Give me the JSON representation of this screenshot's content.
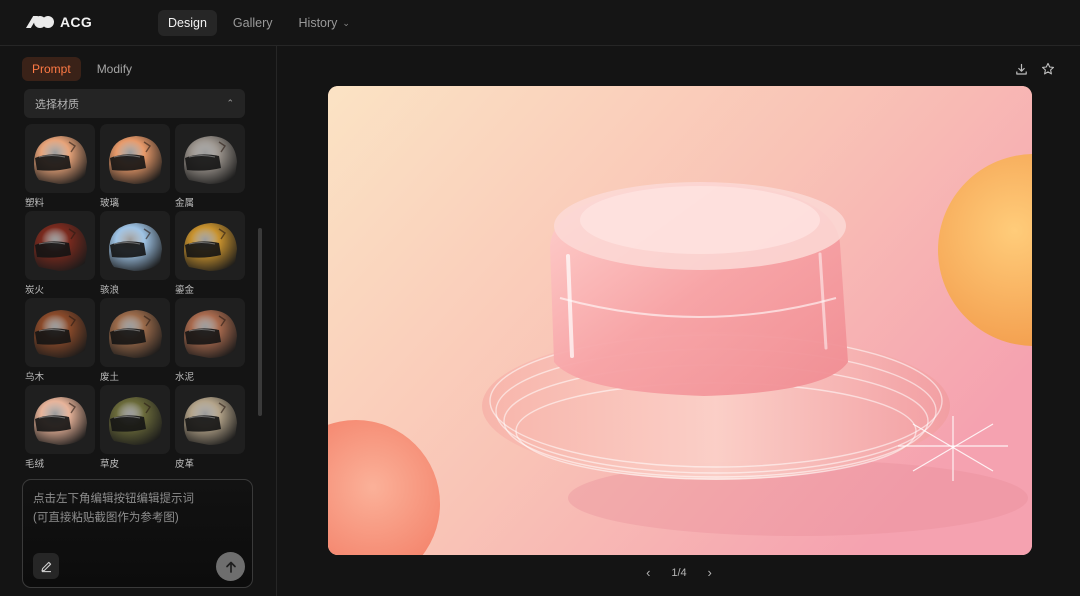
{
  "app": {
    "name": "ACG"
  },
  "nav": [
    {
      "label": "Design",
      "active": true
    },
    {
      "label": "Gallery",
      "active": false
    },
    {
      "label": "History",
      "active": false
    }
  ],
  "left": {
    "tabs": [
      {
        "label": "Prompt",
        "active": true
      },
      {
        "label": "Modify",
        "active": false
      }
    ],
    "material_select": {
      "label": "选择材质"
    },
    "materials": [
      {
        "label": "塑料",
        "color": "#e8a47a"
      },
      {
        "label": "玻璃",
        "color": "#e89a6a"
      },
      {
        "label": "金属",
        "color": "#9a938c"
      },
      {
        "label": "炭火",
        "color": "#7a2a1e"
      },
      {
        "label": "骇浪",
        "color": "#9fc4e6"
      },
      {
        "label": "鎏金",
        "color": "#c8922e"
      },
      {
        "label": "乌木",
        "color": "#8a4a2a"
      },
      {
        "label": "废土",
        "color": "#9a6a4a"
      },
      {
        "label": "水泥",
        "color": "#a86a4e"
      },
      {
        "label": "毛绒",
        "color": "#e8b49a"
      },
      {
        "label": "草皮",
        "color": "#6a6a3a"
      },
      {
        "label": "皮革",
        "color": "#b4a48a"
      }
    ],
    "prompt": {
      "placeholder": "点击左下角编辑按钮编辑提示词\n(可直接粘贴截图作为参考图)"
    }
  },
  "main": {
    "pager": {
      "text": "1/4"
    }
  },
  "colors": {
    "accent": "#ff7a45",
    "accent_bg": "#3a2218",
    "background": "#141414"
  }
}
